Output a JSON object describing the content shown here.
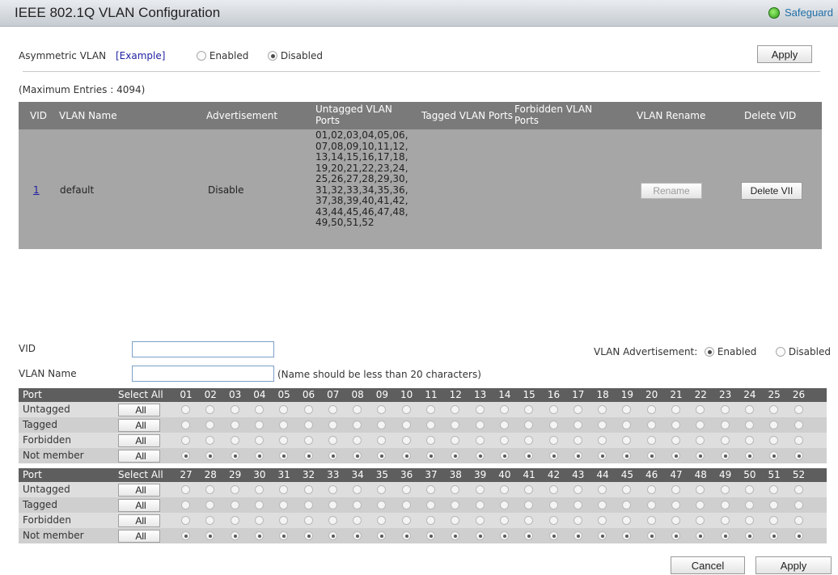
{
  "header": {
    "title": "IEEE 802.1Q VLAN Configuration",
    "safeguard": "Safeguard"
  },
  "asym": {
    "label": "Asymmetric VLAN",
    "example": "[Example]",
    "enabled": "Enabled",
    "disabled": "Disabled",
    "selected": "Disabled",
    "apply": "Apply"
  },
  "table": {
    "max_entries": "(Maximum Entries : 4094)",
    "headers": {
      "vid": "VID",
      "name": "VLAN Name",
      "adv": "Advertisement",
      "untagged": "Untagged VLAN Ports",
      "tagged": "Tagged VLAN Ports",
      "forbidden": "Forbidden VLAN Ports",
      "rename": "VLAN Rename",
      "delete": "Delete VID"
    },
    "row": {
      "vid": "1",
      "name": "default",
      "adv": "Disable",
      "untagged": "01,02,03,04,05,06,07,08,09,10,11,12,13,14,15,16,17,18,19,20,21,22,23,24,25,26,27,28,29,30,31,32,33,34,35,36,37,38,39,40,41,42,43,44,45,46,47,48,49,50,51,52",
      "rename_btn": "Rename",
      "delete_btn": "Delete VII"
    }
  },
  "form": {
    "vid_label": "VID",
    "vid_value": "",
    "name_label": "VLAN Name",
    "name_value": "",
    "name_hint": "(Name should be less than 20 characters)",
    "adv_label": "VLAN Advertisement:",
    "adv_enabled": "Enabled",
    "adv_disabled": "Disabled",
    "adv_selected": "Enabled"
  },
  "ports": {
    "port_label": "Port",
    "select_all": "Select All",
    "all_btn": "All",
    "rows": [
      "Untagged",
      "Tagged",
      "Forbidden",
      "Not member"
    ],
    "selected_row": "Not member",
    "group1": [
      "01",
      "02",
      "03",
      "04",
      "05",
      "06",
      "07",
      "08",
      "09",
      "10",
      "11",
      "12",
      "13",
      "14",
      "15",
      "16",
      "17",
      "18",
      "19",
      "20",
      "21",
      "22",
      "23",
      "24",
      "25",
      "26"
    ],
    "group2": [
      "27",
      "28",
      "29",
      "30",
      "31",
      "32",
      "33",
      "34",
      "35",
      "36",
      "37",
      "38",
      "39",
      "40",
      "41",
      "42",
      "43",
      "44",
      "45",
      "46",
      "47",
      "48",
      "49",
      "50",
      "51",
      "52"
    ]
  },
  "footer": {
    "cancel": "Cancel",
    "apply": "Apply"
  }
}
